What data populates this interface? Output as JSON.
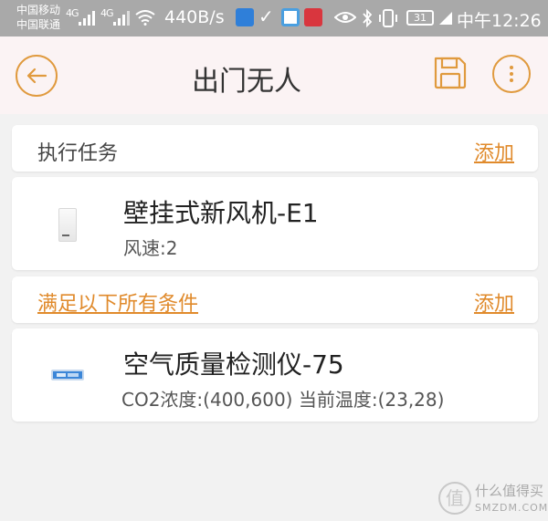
{
  "status_bar": {
    "carrier_1": "中国移动",
    "carrier_2": "中国联通",
    "signal_1": "4G",
    "signal_2": "4G",
    "speed": "440B/s",
    "battery": "31",
    "time": "中午12:26",
    "icons": [
      "wifi-icon",
      "shield-app-icon",
      "check-icon",
      "camera-app-icon",
      "red-app-icon",
      "eye-icon",
      "bluetooth-icon",
      "vibrate-icon",
      "battery-icon"
    ]
  },
  "header": {
    "title": "出门无人",
    "back_icon": "arrow-left-icon",
    "save_icon": "floppy-disk-icon",
    "more_icon": "more-vertical-icon",
    "accent_color": "#e08a2b"
  },
  "tasks_section": {
    "label": "执行任务",
    "add_label": "添加"
  },
  "task_item": {
    "name": "壁挂式新风机-E1",
    "detail": "风速:2",
    "icon": "wall-ventilator-icon"
  },
  "conditions_section": {
    "label": "满足以下所有条件",
    "add_label": "添加"
  },
  "condition_item": {
    "name": "空气质量检测仪-75",
    "detail": "CO2浓度:(400,600) 当前温度:(23,28)",
    "icon": "air-quality-monitor-icon"
  },
  "watermark": {
    "text": "什么值得买",
    "sub": "SMZDM.COM",
    "logo_glyph": "值"
  }
}
